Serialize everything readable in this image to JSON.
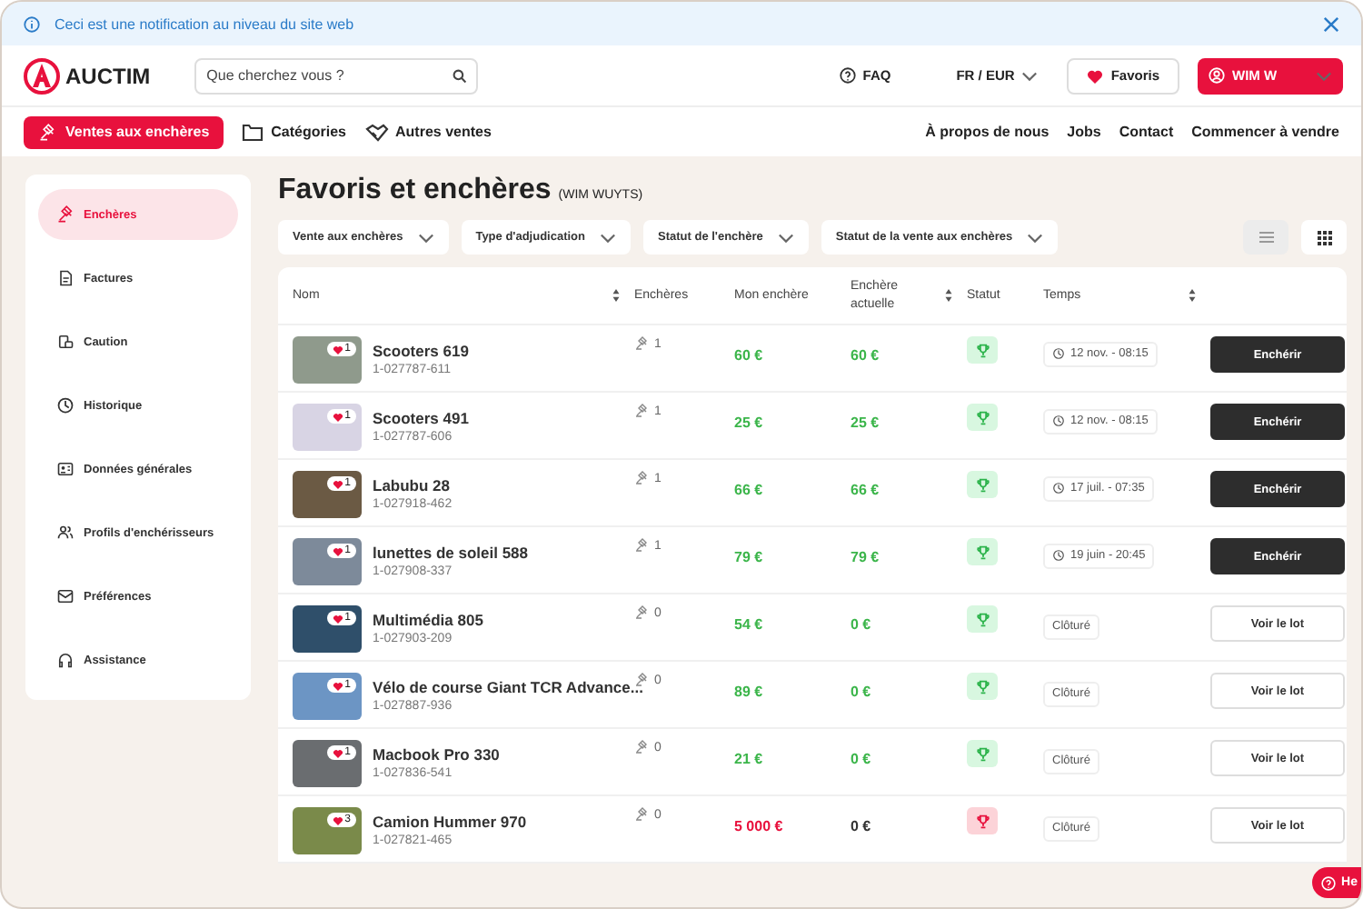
{
  "notification": {
    "text": "Ceci est une notification au niveau du site web"
  },
  "header": {
    "brand": "AUCTIM",
    "search": {
      "placeholder": "Que cherchez vous ?"
    },
    "faq": "FAQ",
    "locale": "FR / EUR",
    "favorites": "Favoris",
    "user": "WIM W"
  },
  "nav": {
    "primary": "Ventes aux enchères",
    "items": [
      "Catégories",
      "Autres ventes"
    ],
    "links": [
      "À propos de nous",
      "Jobs",
      "Contact",
      "Commencer à vendre"
    ]
  },
  "sidebar": {
    "items": [
      {
        "label": "Enchères",
        "selected": true
      },
      {
        "label": "Factures",
        "selected": false
      },
      {
        "label": "Caution",
        "selected": false
      },
      {
        "label": "Historique",
        "selected": false
      },
      {
        "label": "Données générales",
        "selected": false
      },
      {
        "label": "Profils d'enchérisseurs",
        "selected": false
      },
      {
        "label": "Préférences",
        "selected": false
      },
      {
        "label": "Assistance",
        "selected": false
      }
    ]
  },
  "page": {
    "title": "Favoris et enchères",
    "subtitle": "(WIM WUYTS)"
  },
  "filters": [
    "Vente aux enchères",
    "Type d'adjudication",
    "Statut de l'enchère",
    "Statut de la vente aux enchères"
  ],
  "view_toggle": {
    "list_selected": true
  },
  "table": {
    "columns": [
      {
        "label": "Nom",
        "sortable": true
      },
      {
        "label": "Enchères",
        "sortable": false
      },
      {
        "label": "Mon enchère",
        "sortable": false
      },
      {
        "label": "Enchère actuelle",
        "sortable": true
      },
      {
        "label": "Statut",
        "sortable": false
      },
      {
        "label": "Temps",
        "sortable": true
      }
    ],
    "rows": [
      {
        "likes": "1",
        "name": "Scooters 619",
        "lot": "1-027787-611",
        "bids": "1",
        "my_bid": "60 €",
        "current_bid": "60 €",
        "winning": true,
        "closed": false,
        "time": "12 nov. - 08:15",
        "action": "Enchérir"
      },
      {
        "likes": "1",
        "name": "Scooters 491",
        "lot": "1-027787-606",
        "bids": "1",
        "my_bid": "25 €",
        "current_bid": "25 €",
        "winning": true,
        "closed": false,
        "time": "12 nov. - 08:15",
        "action": "Enchérir"
      },
      {
        "likes": "1",
        "name": "Labubu 28",
        "lot": "1-027918-462",
        "bids": "1",
        "my_bid": "66 €",
        "current_bid": "66 €",
        "winning": true,
        "closed": false,
        "time": "17 juil. - 07:35",
        "action": "Enchérir"
      },
      {
        "likes": "1",
        "name": "lunettes de soleil 588",
        "lot": "1-027908-337",
        "bids": "1",
        "my_bid": "79 €",
        "current_bid": "79 €",
        "winning": true,
        "closed": false,
        "time": "19 juin - 20:45",
        "action": "Enchérir"
      },
      {
        "likes": "1",
        "name": "Multimédia 805",
        "lot": "1-027903-209",
        "bids": "0",
        "my_bid": "54 €",
        "current_bid": "0 €",
        "winning": true,
        "closed": true,
        "time": "Clôturé",
        "action": "Voir le lot"
      },
      {
        "likes": "1",
        "name": "Vélo de course Giant TCR Advance...",
        "lot": "1-027887-936",
        "bids": "0",
        "my_bid": "89 €",
        "current_bid": "0 €",
        "winning": true,
        "closed": true,
        "time": "Clôturé",
        "action": "Voir le lot"
      },
      {
        "likes": "1",
        "name": "Macbook Pro 330",
        "lot": "1-027836-541",
        "bids": "0",
        "my_bid": "21 €",
        "current_bid": "0 €",
        "winning": true,
        "closed": true,
        "time": "Clôturé",
        "action": "Voir le lot"
      },
      {
        "likes": "3",
        "name": "Camion Hummer 970",
        "lot": "1-027821-465",
        "bids": "0",
        "my_bid": "5 000 €",
        "current_bid": "0 €",
        "winning": false,
        "closed": true,
        "time": "Clôturé",
        "action": "Voir le lot"
      }
    ]
  },
  "help_button": "He"
}
